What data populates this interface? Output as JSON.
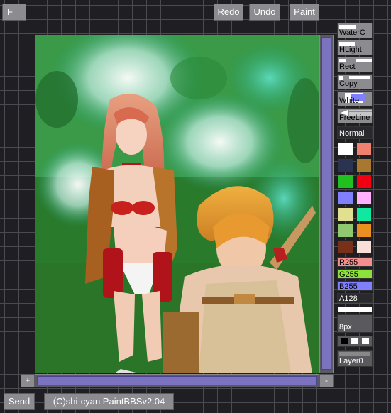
{
  "top": {
    "f_label": "F",
    "redo_label": "Redo",
    "undo_label": "Undo",
    "paint_label": "Paint"
  },
  "tools": {
    "watercolor": "WaterC",
    "highlight": "HLight",
    "rect": "Rect",
    "copy": "Copy",
    "white": "White",
    "freeline": "FreeLine",
    "normal": "Normal"
  },
  "palette": [
    "#ffffff",
    "#f08070",
    "#2a3450",
    "#a87830",
    "#20c020",
    "#f00010",
    "#8080ff",
    "#ffb0ff",
    "#e0e090",
    "#10e8a0",
    "#90c870",
    "#e89020",
    "#783018",
    "#f8e0d8"
  ],
  "sliders": {
    "r": "R255",
    "g": "G255",
    "b": "B255",
    "a": "A128"
  },
  "size_label": "8px",
  "layer_label": "Layer0",
  "bottom": {
    "plus_label": "+",
    "minus_label": "-",
    "send_label": "Send",
    "credit": "(C)shi-cyan PaintBBSv2.04"
  },
  "colors": {
    "scroll_purple": "#7b72c0",
    "button_gray": "#8c8c90",
    "slider_r": "#f29090",
    "slider_g": "#8ce03c",
    "slider_b": "#8080ff"
  }
}
